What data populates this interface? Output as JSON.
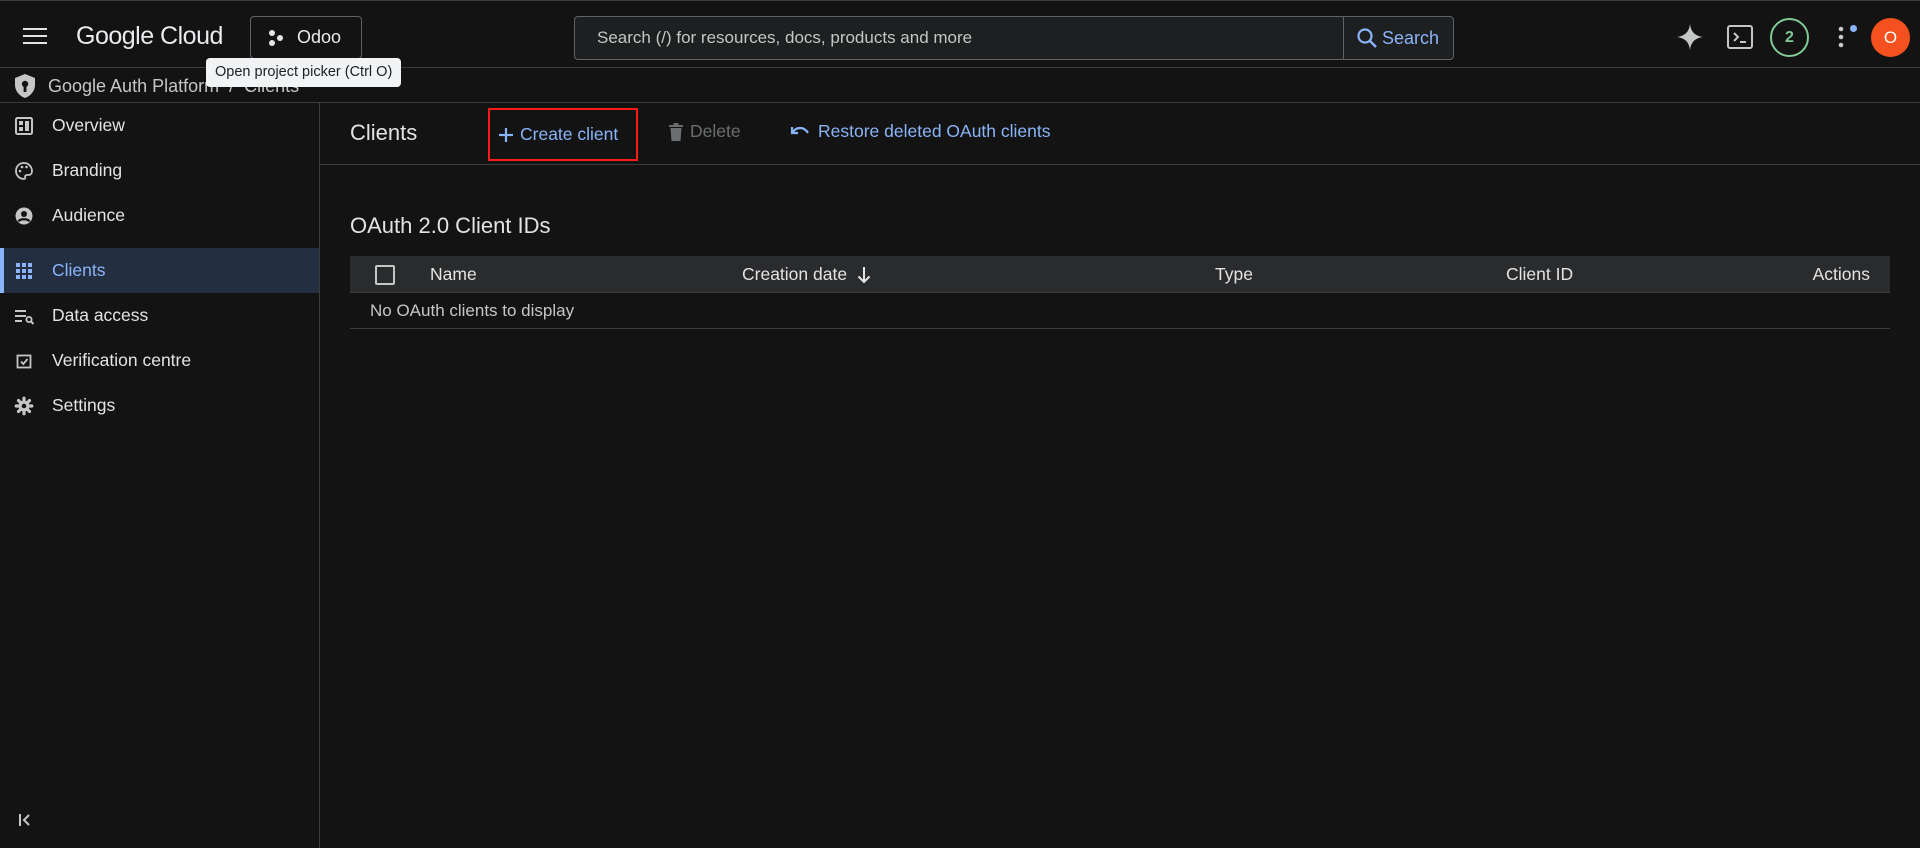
{
  "header": {
    "logo": "Google Cloud",
    "project_name": "Odoo",
    "tooltip": "Open project picker (Ctrl O)",
    "search_placeholder": "Search (/) for resources, docs, products and more",
    "search_label": "Search",
    "notifications_count": "2",
    "avatar_initial": "O"
  },
  "breadcrumb": {
    "product": "Google Auth Platform",
    "separator": "/",
    "page": "Clients"
  },
  "sidebar": {
    "items": [
      {
        "label": "Overview",
        "icon": "dashboard-icon"
      },
      {
        "label": "Branding",
        "icon": "palette-icon"
      },
      {
        "label": "Audience",
        "icon": "account-circle-icon"
      },
      {
        "label": "Clients",
        "icon": "apps-grid-icon",
        "active": true
      },
      {
        "label": "Data access",
        "icon": "data-list-icon"
      },
      {
        "label": "Verification centre",
        "icon": "verified-checkbox-icon"
      },
      {
        "label": "Settings",
        "icon": "gear-icon"
      }
    ]
  },
  "toolbar": {
    "title": "Clients",
    "create_label": "Create client",
    "delete_label": "Delete",
    "restore_label": "Restore deleted OAuth clients"
  },
  "table": {
    "section_title": "OAuth 2.0 Client IDs",
    "columns": [
      "Name",
      "Creation date",
      "Type",
      "Client ID",
      "Actions"
    ],
    "empty_message": "No OAuth clients to display"
  },
  "colors": {
    "accent": "#8ab4f8",
    "highlight_border": "#ff1a1a",
    "avatar": "#f4511e",
    "badge": "#81c995"
  }
}
